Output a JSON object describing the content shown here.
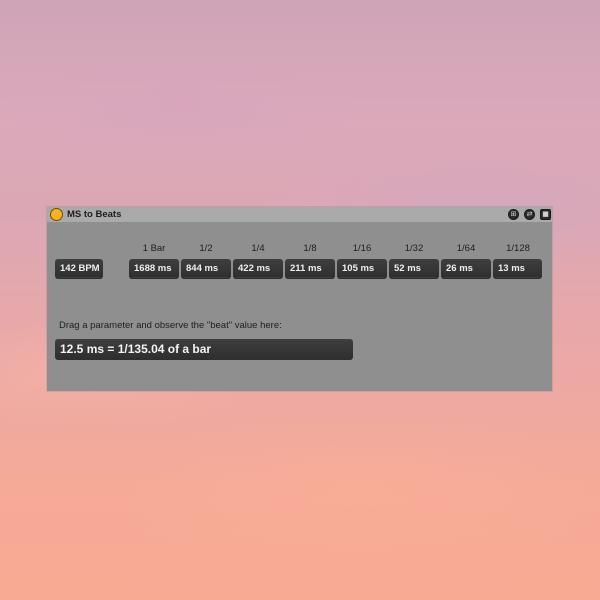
{
  "device": {
    "title": "MS to Beats",
    "icons": {
      "power": "power-toggle-icon",
      "hotswap": "hotswap-icon",
      "map": "map-icon",
      "save": "save-preset-icon"
    },
    "bpm_value": "142 BPM",
    "divisions": [
      {
        "label": "1 Bar",
        "value": "1688 ms"
      },
      {
        "label": "1/2",
        "value": "844 ms"
      },
      {
        "label": "1/4",
        "value": "422 ms"
      },
      {
        "label": "1/8",
        "value": "211 ms"
      },
      {
        "label": "1/16",
        "value": "105 ms"
      },
      {
        "label": "1/32",
        "value": "52 ms"
      },
      {
        "label": "1/64",
        "value": "26 ms"
      },
      {
        "label": "1/128",
        "value": "13 ms"
      }
    ],
    "instruction": "Drag a parameter and observe the \"beat\" value here:",
    "result": "12.5 ms = 1/135.04 of a bar"
  },
  "colors": {
    "power_accent": "#f7b21a",
    "device_bg": "#8f8f8f",
    "title_bar_bg": "#aaaaaa",
    "box_bg": "#333333",
    "box_text": "#f0f0f0"
  }
}
